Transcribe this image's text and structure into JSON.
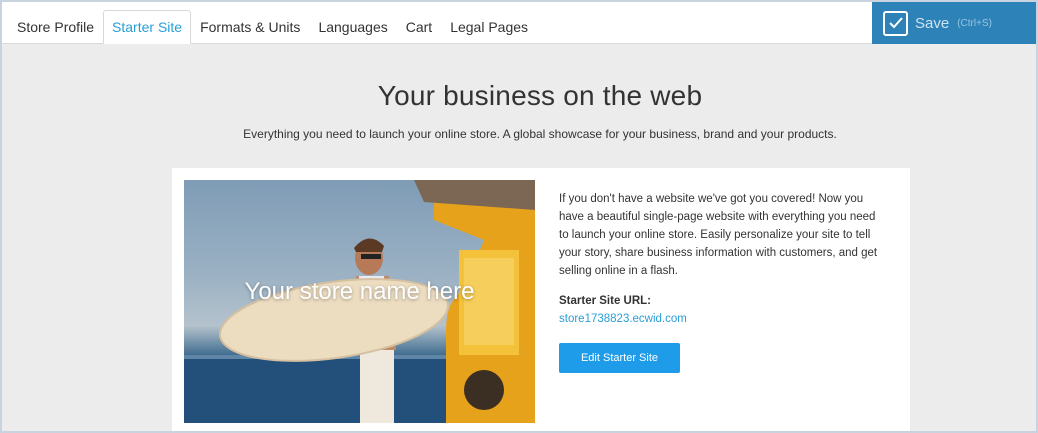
{
  "tabs": [
    {
      "label": "Store Profile",
      "active": false
    },
    {
      "label": "Starter Site",
      "active": true
    },
    {
      "label": "Formats & Units",
      "active": false
    },
    {
      "label": "Languages",
      "active": false
    },
    {
      "label": "Cart",
      "active": false
    },
    {
      "label": "Legal Pages",
      "active": false
    }
  ],
  "save": {
    "label": "Save",
    "shortcut": "(Ctrl+S)",
    "icon": "checkmark-icon"
  },
  "header": {
    "title": "Your business on the web",
    "subtitle": "Everything you need to launch your online store. A global showcase for your business, brand and your products."
  },
  "card": {
    "hero_text": "Your store name here",
    "description": "If you don't have a website we've got you covered! Now you have a beautiful single-page website with everything you need to launch your online store. Easily personalize your site to tell your story, share business information with customers, and get selling online in a flash.",
    "url_label": "Starter Site URL:",
    "url": "store1738823.ecwid.com",
    "edit_button": "Edit Starter Site"
  },
  "colors": {
    "accent": "#2a9fd6",
    "save_bg": "#2d82b7",
    "button_bg": "#1e9cea",
    "page_bg": "#ececec"
  }
}
